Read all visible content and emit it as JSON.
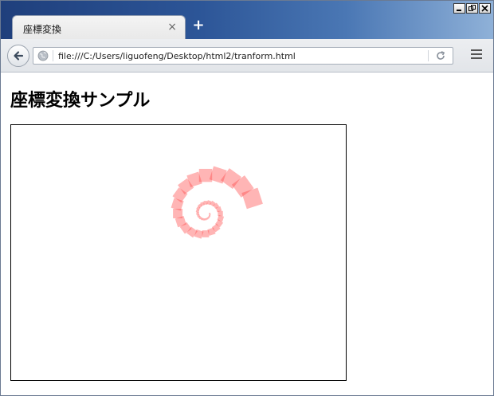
{
  "tab": {
    "title": "座標変換",
    "close_glyph": "×",
    "new_tab_glyph": "+"
  },
  "window_controls": [
    "minimize-icon",
    "restore-icon",
    "close-icon"
  ],
  "nav": {
    "back_icon": "back-arrow-icon",
    "site_icon": "globe-icon",
    "url": "file:///C:/Users/liguofeng/Desktop/html2/tranform.html",
    "reload_icon": "reload-icon",
    "menu_icon": "hamburger-menu-icon"
  },
  "page": {
    "heading": "座標変換サンプル"
  },
  "canvas": {
    "fill_color": "#ff3c3c",
    "fill_opacity": 0.38,
    "square_count": 40
  },
  "colors": {
    "titlebar": "#2c5597",
    "navbar": "#e6e9ed",
    "square": "#ff3c3c"
  }
}
